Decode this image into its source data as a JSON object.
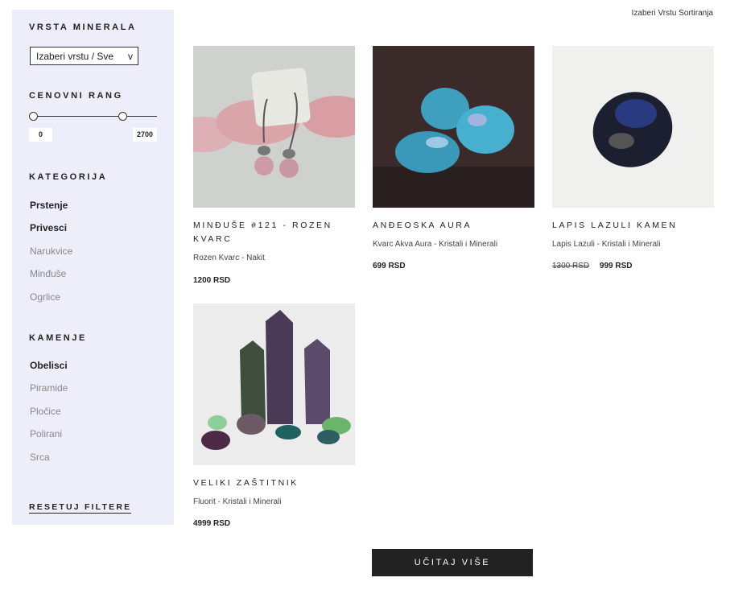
{
  "sidebar": {
    "mineral_heading": "VRSTA MINERALA",
    "mineral_select_value": "Izaberi vrstu / Sve",
    "mineral_select_chevron": "v",
    "price_heading": "CENOVNI RANG",
    "price_min": "0",
    "price_max": "2700",
    "category_heading": "KATEGORIJA",
    "categories": [
      {
        "label": "Prstenje",
        "active": true
      },
      {
        "label": "Privesci",
        "active": true
      },
      {
        "label": "Narukvice",
        "active": false
      },
      {
        "label": "Minđuše",
        "active": false
      },
      {
        "label": "Ogrlice",
        "active": false
      }
    ],
    "stones_heading": "KAMENJE",
    "stones": [
      {
        "label": "Obelisci",
        "active": true
      },
      {
        "label": "Piramide",
        "active": false
      },
      {
        "label": "Pločice",
        "active": false
      },
      {
        "label": "Polirani",
        "active": false
      },
      {
        "label": "Srca",
        "active": false
      }
    ],
    "reset_label": "RESETUJ FILTERE"
  },
  "sort_label": "Izaberi Vrstu Sortiranja",
  "products": [
    {
      "name": "MINĐUŠE #121 - ROZEN KVARC",
      "subtitle": "Rozen Kvarc - Nakit",
      "old_price": "",
      "price": "1200 RSD"
    },
    {
      "name": "ANĐEOSKA AURA",
      "subtitle": "Kvarc Akva Aura - Kristali i Minerali",
      "old_price": "",
      "price": "699 RSD"
    },
    {
      "name": "LAPIS LAZULI KAMEN",
      "subtitle": "Lapis Lazuli - Kristali i Minerali",
      "old_price": "1300 RSD",
      "price": "999 RSD"
    },
    {
      "name": "VELIKI ZAŠTITNIK",
      "subtitle": "Fluorit - Kristali i Minerali",
      "old_price": "",
      "price": "4999 RSD"
    }
  ],
  "load_more_label": "UČITAJ VIŠE",
  "colors": {
    "sidebar_bg": "#eeeefb",
    "button_bg": "#222222",
    "text": "#222222"
  }
}
